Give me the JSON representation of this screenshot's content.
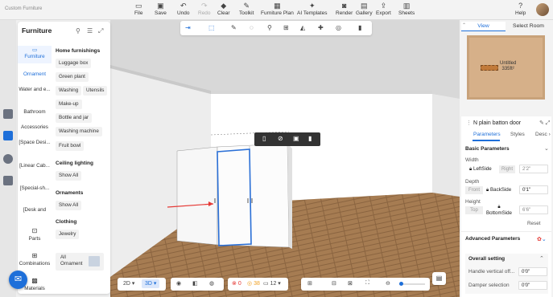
{
  "app_title": "Custom Furniture",
  "toolbar": {
    "file": "File",
    "save": "Save",
    "undo": "Undo",
    "redo": "Redo",
    "clear": "Clear",
    "toolkit": "Toolkit",
    "furniture_plan": "Furniture Plan",
    "ai_templates": "AI Templates",
    "render": "Render",
    "gallery": "Gallery",
    "export": "Export",
    "sheets": "Sheets",
    "help": "Help"
  },
  "furniture_panel": {
    "title": "Furniture",
    "categories": [
      "Furniture",
      "Ornament",
      "Water and e...",
      "Bathroom",
      "Accessories",
      "[Space Desi...",
      "[Linear Cab...",
      "[Special-sh...",
      "[Desk and"
    ],
    "sections": {
      "home_furnishings": "Home furnishings",
      "ceiling_lighting": "Ceiling lighting",
      "ornaments": "Ornaments",
      "clothing": "Clothing"
    },
    "home_items": [
      "Luggage box",
      "Green plant",
      "Washing",
      "Utensils",
      "Make-up",
      "Bottle and jar",
      "Washing machine",
      "Fruit bowl"
    ],
    "ceiling_items": [
      "Show All"
    ],
    "ornament_items": [
      "Show All"
    ],
    "clothing_items": [
      "Jewelry"
    ],
    "all_ornament": "All Ornament",
    "bottom_tools": [
      "Parts",
      "Combinations",
      "Materials"
    ]
  },
  "bottom_toolbar": {
    "view_2d": "2D",
    "view_3d": "3D",
    "errors": "0",
    "warnings": "38",
    "count": "12"
  },
  "right_panel": {
    "tabs": [
      "View",
      "Select Room"
    ],
    "room_label": "Untitled",
    "room_area": "335ft²",
    "object_title": "N plain batton door",
    "prop_tabs": [
      "Parameters",
      "Styles",
      "Desc"
    ],
    "basic_params": "Basic Parameters",
    "width_label": "Width",
    "width_left": "LeftSide",
    "width_right": "Right",
    "width_value": "2'2\"",
    "depth_label": "Depth",
    "depth_front": "Front",
    "depth_back": "BackSide",
    "depth_value": "0'1\"",
    "height_label": "Height",
    "height_top": "Top",
    "height_bottom": "BottomSide",
    "height_value": "6'6\"",
    "reset": "Reset",
    "advanced_params": "Advanced Parameters",
    "overall_setting": "Overall setting",
    "handle_label": "Handle vertical off...",
    "handle_value": "0'0\"",
    "damper_label": "Damper selection",
    "damper_value": "0'0\""
  }
}
